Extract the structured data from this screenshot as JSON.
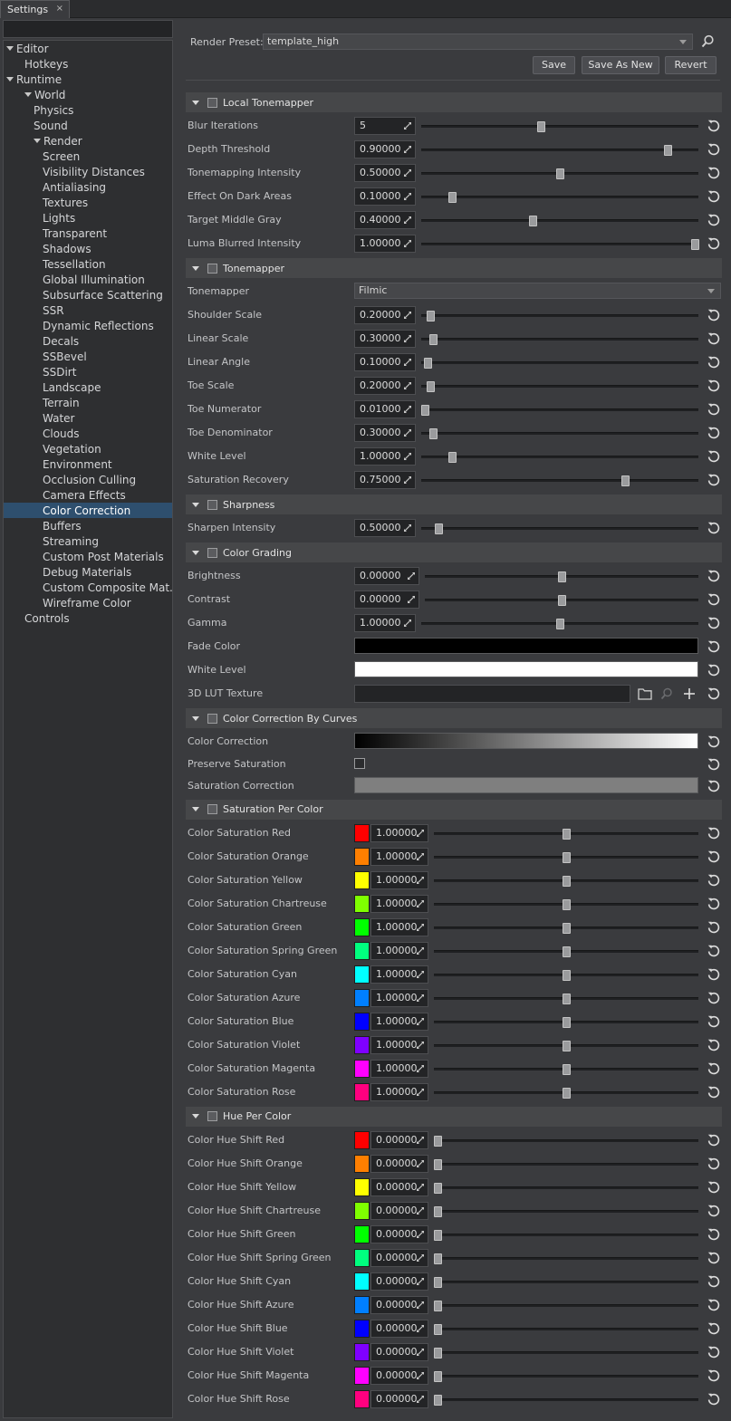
{
  "tab": {
    "title": "Settings",
    "close": "×"
  },
  "sidebar": {
    "items": [
      {
        "label": "Editor",
        "depth": 0,
        "arrow": true
      },
      {
        "label": "Hotkeys",
        "depth": 1
      },
      {
        "label": "Runtime",
        "depth": 0,
        "arrow": true
      },
      {
        "label": "World",
        "depth": 1,
        "arrow": true
      },
      {
        "label": "Physics",
        "depth": 2
      },
      {
        "label": "Sound",
        "depth": 2
      },
      {
        "label": "Render",
        "depth": 2,
        "arrow": true
      },
      {
        "label": "Screen",
        "depth": 3
      },
      {
        "label": "Visibility Distances",
        "depth": 3
      },
      {
        "label": "Antialiasing",
        "depth": 3
      },
      {
        "label": "Textures",
        "depth": 3
      },
      {
        "label": "Lights",
        "depth": 3
      },
      {
        "label": "Transparent",
        "depth": 3
      },
      {
        "label": "Shadows",
        "depth": 3
      },
      {
        "label": "Tessellation",
        "depth": 3
      },
      {
        "label": "Global Illumination",
        "depth": 3
      },
      {
        "label": "Subsurface Scattering",
        "depth": 3
      },
      {
        "label": "SSR",
        "depth": 3
      },
      {
        "label": "Dynamic Reflections",
        "depth": 3
      },
      {
        "label": "Decals",
        "depth": 3
      },
      {
        "label": "SSBevel",
        "depth": 3
      },
      {
        "label": "SSDirt",
        "depth": 3
      },
      {
        "label": "Landscape",
        "depth": 3
      },
      {
        "label": "Terrain",
        "depth": 3
      },
      {
        "label": "Water",
        "depth": 3
      },
      {
        "label": "Clouds",
        "depth": 3
      },
      {
        "label": "Vegetation",
        "depth": 3
      },
      {
        "label": "Environment",
        "depth": 3
      },
      {
        "label": "Occlusion Culling",
        "depth": 3
      },
      {
        "label": "Camera Effects",
        "depth": 3
      },
      {
        "label": "Color Correction",
        "depth": 3,
        "selected": true
      },
      {
        "label": "Buffers",
        "depth": 3
      },
      {
        "label": "Streaming",
        "depth": 3
      },
      {
        "label": "Custom Post Materials",
        "depth": 3
      },
      {
        "label": "Debug Materials",
        "depth": 3
      },
      {
        "label": "Custom Composite Mat...",
        "depth": 3
      },
      {
        "label": "Wireframe Color",
        "depth": 3
      },
      {
        "label": "Controls",
        "depth": 1
      }
    ]
  },
  "header": {
    "preset_label": "Render Preset:",
    "preset_value": "template_high",
    "save": "Save",
    "save_as_new": "Save As New",
    "revert": "Revert"
  },
  "sections": [
    {
      "title": "Local Tonemapper",
      "rows": [
        {
          "type": "slider",
          "label": "Blur Iterations",
          "value": "5",
          "level": 0.43
        },
        {
          "type": "slider",
          "label": "Depth Threshold",
          "value": "0.90000",
          "level": 0.9
        },
        {
          "type": "slider",
          "label": "Tonemapping Intensity",
          "value": "0.50000",
          "level": 0.5
        },
        {
          "type": "slider",
          "label": "Effect On Dark Areas",
          "value": "0.10000",
          "level": 0.1
        },
        {
          "type": "slider",
          "label": "Target Middle Gray",
          "value": "0.40000",
          "level": 0.4
        },
        {
          "type": "slider",
          "label": "Luma Blurred Intensity",
          "value": "1.00000",
          "level": 1.0
        }
      ]
    },
    {
      "title": "Tonemapper",
      "rows": [
        {
          "type": "combo",
          "label": "Tonemapper",
          "value": "Filmic"
        },
        {
          "type": "slider",
          "label": "Shoulder Scale",
          "value": "0.20000",
          "level": 0.02
        },
        {
          "type": "slider",
          "label": "Linear Scale",
          "value": "0.30000",
          "level": 0.03
        },
        {
          "type": "slider",
          "label": "Linear Angle",
          "value": "0.10000",
          "level": 0.01
        },
        {
          "type": "slider",
          "label": "Toe Scale",
          "value": "0.20000",
          "level": 0.02
        },
        {
          "type": "slider",
          "label": "Toe Numerator",
          "value": "0.01000",
          "level": 0.0
        },
        {
          "type": "slider",
          "label": "Toe Denominator",
          "value": "0.30000",
          "level": 0.03
        },
        {
          "type": "slider",
          "label": "White Level",
          "value": "1.00000",
          "level": 0.1
        },
        {
          "type": "slider",
          "label": "Saturation Recovery",
          "value": "0.75000",
          "level": 0.74
        }
      ]
    },
    {
      "title": "Sharpness",
      "rows": [
        {
          "type": "slider",
          "label": "Sharpen Intensity",
          "value": "0.50000",
          "level": 0.05
        }
      ]
    },
    {
      "title": "Color Grading",
      "rows": [
        {
          "type": "slider",
          "wide": true,
          "label": "Brightness",
          "value": "0.00000",
          "level": 0.5
        },
        {
          "type": "slider",
          "wide": true,
          "label": "Contrast",
          "value": "0.00000",
          "level": 0.5
        },
        {
          "type": "slider",
          "label": "Gamma",
          "value": "1.00000",
          "level": 0.5
        },
        {
          "type": "colorbar",
          "label": "Fade Color",
          "color": "#000000"
        },
        {
          "type": "colorbar",
          "label": "White Level",
          "color": "#ffffff"
        },
        {
          "type": "texture",
          "label": "3D LUT Texture"
        }
      ]
    },
    {
      "title": "Color Correction By Curves",
      "rows": [
        {
          "type": "gradient",
          "label": "Color Correction"
        },
        {
          "type": "checkbox",
          "label": "Preserve Saturation"
        },
        {
          "type": "colorbar",
          "label": "Saturation Correction",
          "color": "#7f7f7f"
        }
      ]
    },
    {
      "title": "Saturation Per Color",
      "rows": [
        {
          "type": "swatch",
          "label": "Color Saturation Red",
          "value": "1.00000",
          "color": "#ff0000",
          "level": 0.5
        },
        {
          "type": "swatch",
          "label": "Color Saturation Orange",
          "value": "1.00000",
          "color": "#ff7f00",
          "level": 0.5
        },
        {
          "type": "swatch",
          "label": "Color Saturation Yellow",
          "value": "1.00000",
          "color": "#ffff00",
          "level": 0.5
        },
        {
          "type": "swatch",
          "label": "Color Saturation Chartreuse",
          "value": "1.00000",
          "color": "#7fff00",
          "level": 0.5
        },
        {
          "type": "swatch",
          "label": "Color Saturation Green",
          "value": "1.00000",
          "color": "#00ff00",
          "level": 0.5
        },
        {
          "type": "swatch",
          "label": "Color Saturation Spring Green",
          "value": "1.00000",
          "color": "#00ff7f",
          "level": 0.5
        },
        {
          "type": "swatch",
          "label": "Color Saturation Cyan",
          "value": "1.00000",
          "color": "#00ffff",
          "level": 0.5
        },
        {
          "type": "swatch",
          "label": "Color Saturation Azure",
          "value": "1.00000",
          "color": "#007fff",
          "level": 0.5
        },
        {
          "type": "swatch",
          "label": "Color Saturation Blue",
          "value": "1.00000",
          "color": "#0000ff",
          "level": 0.5
        },
        {
          "type": "swatch",
          "label": "Color Saturation Violet",
          "value": "1.00000",
          "color": "#7f00ff",
          "level": 0.5
        },
        {
          "type": "swatch",
          "label": "Color Saturation Magenta",
          "value": "1.00000",
          "color": "#ff00ff",
          "level": 0.5
        },
        {
          "type": "swatch",
          "label": "Color Saturation Rose",
          "value": "1.00000",
          "color": "#ff007f",
          "level": 0.5
        }
      ]
    },
    {
      "title": "Hue Per Color",
      "rows": [
        {
          "type": "swatch",
          "label": "Color Hue Shift Red",
          "value": "0.00000",
          "color": "#ff0000",
          "level": 0.0
        },
        {
          "type": "swatch",
          "label": "Color Hue Shift Orange",
          "value": "0.00000",
          "color": "#ff7f00",
          "level": 0.0
        },
        {
          "type": "swatch",
          "label": "Color Hue Shift Yellow",
          "value": "0.00000",
          "color": "#ffff00",
          "level": 0.0
        },
        {
          "type": "swatch",
          "label": "Color Hue Shift Chartreuse",
          "value": "0.00000",
          "color": "#7fff00",
          "level": 0.0
        },
        {
          "type": "swatch",
          "label": "Color Hue Shift Green",
          "value": "0.00000",
          "color": "#00ff00",
          "level": 0.0
        },
        {
          "type": "swatch",
          "label": "Color Hue Shift Spring Green",
          "value": "0.00000",
          "color": "#00ff7f",
          "level": 0.0
        },
        {
          "type": "swatch",
          "label": "Color Hue Shift Cyan",
          "value": "0.00000",
          "color": "#00ffff",
          "level": 0.0
        },
        {
          "type": "swatch",
          "label": "Color Hue Shift Azure",
          "value": "0.00000",
          "color": "#007fff",
          "level": 0.0
        },
        {
          "type": "swatch",
          "label": "Color Hue Shift Blue",
          "value": "0.00000",
          "color": "#0000ff",
          "level": 0.0
        },
        {
          "type": "swatch",
          "label": "Color Hue Shift Violet",
          "value": "0.00000",
          "color": "#7f00ff",
          "level": 0.0
        },
        {
          "type": "swatch",
          "label": "Color Hue Shift Magenta",
          "value": "0.00000",
          "color": "#ff00ff",
          "level": 0.0
        },
        {
          "type": "swatch",
          "label": "Color Hue Shift Rose",
          "value": "0.00000",
          "color": "#ff007f",
          "level": 0.0
        }
      ]
    }
  ],
  "icons": {
    "reset": "reset-icon",
    "search": "search-icon",
    "folder": "folder-icon",
    "add": "plus-icon",
    "drag": "drag-arrows-icon"
  },
  "colors": {
    "selection": "#2e4f6e",
    "panel": "#3a3b3e",
    "section_header": "#464749"
  }
}
